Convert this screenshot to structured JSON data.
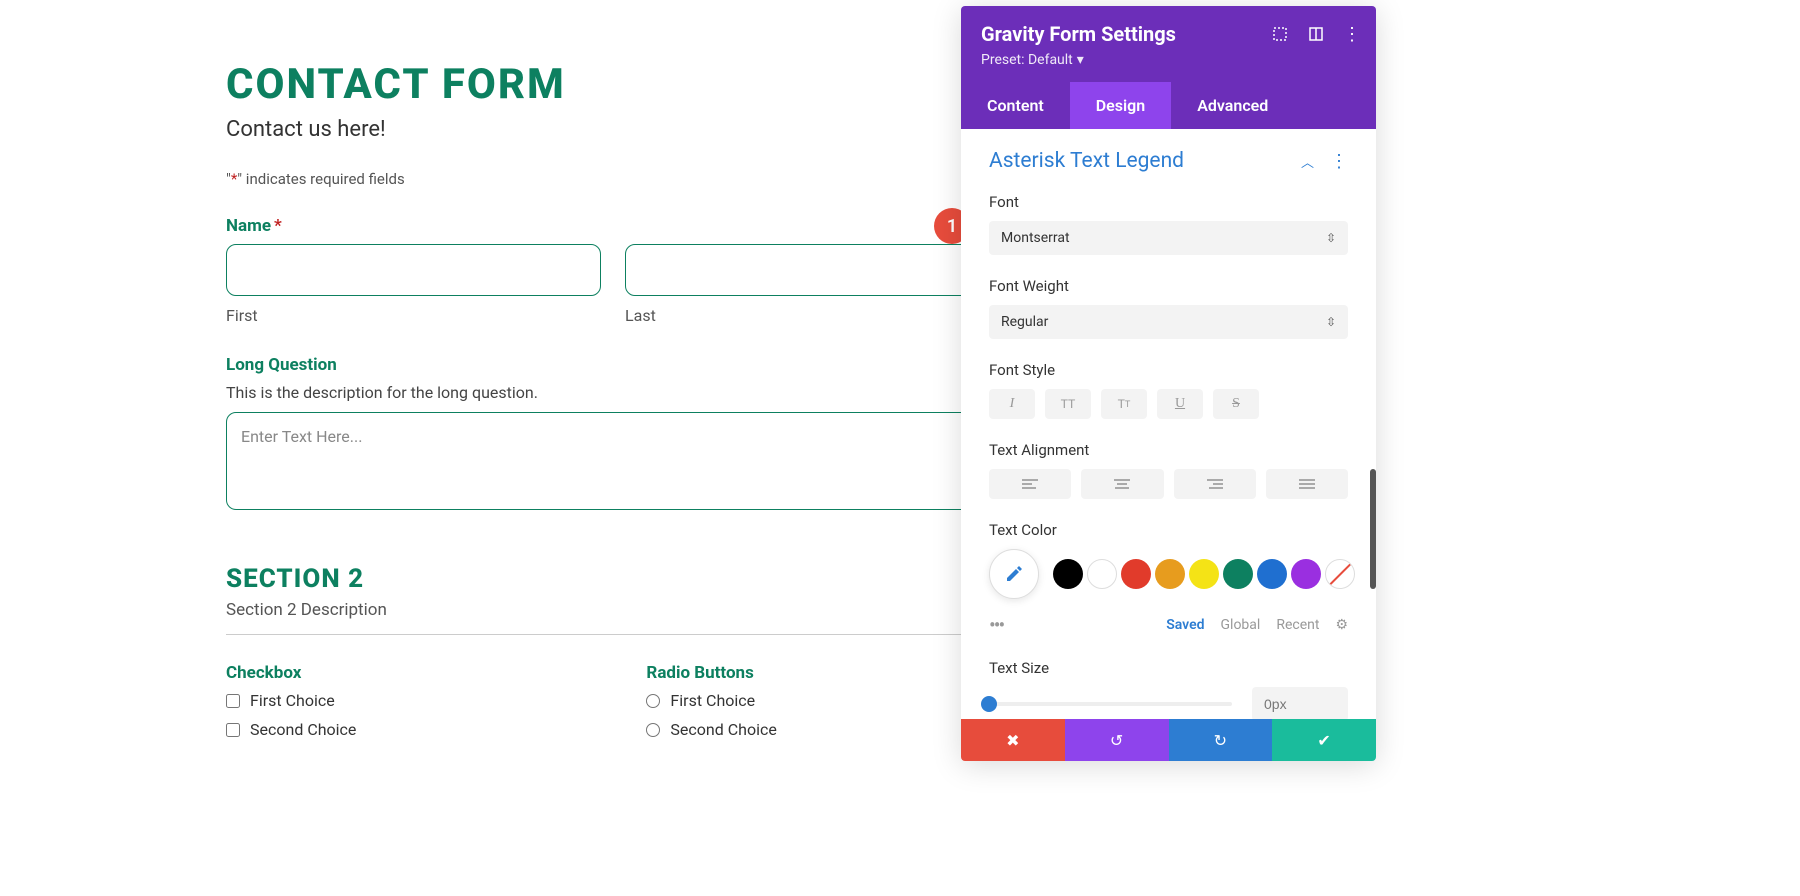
{
  "form": {
    "title": "CONTACT FORM",
    "subtitle": "Contact us here!",
    "required_note_prefix": "\"",
    "required_note_ast": "*",
    "required_note_suffix": "\" indicates required fields",
    "name": {
      "label": "Name",
      "first_label": "First",
      "last_label": "Last"
    },
    "long_question": {
      "label": "Long Question",
      "description": "This is the description for the long question.",
      "placeholder": "Enter Text Here..."
    },
    "section2": {
      "title": "SECTION 2",
      "description": "Section 2 Description"
    },
    "checkbox": {
      "label": "Checkbox",
      "options": [
        "First Choice",
        "Second Choice"
      ]
    },
    "radio": {
      "label": "Radio Buttons",
      "options": [
        "First Choice",
        "Second Choice"
      ]
    }
  },
  "badge": {
    "number": "1"
  },
  "panel": {
    "title": "Gravity Form Settings",
    "preset_label": "Preset: Default",
    "tabs": {
      "content": "Content",
      "design": "Design",
      "advanced": "Advanced"
    },
    "section_title": "Asterisk Text Legend",
    "font": {
      "label": "Font",
      "value": "Montserrat"
    },
    "font_weight": {
      "label": "Font Weight",
      "value": "Regular"
    },
    "font_style": {
      "label": "Font Style"
    },
    "text_alignment": {
      "label": "Text Alignment"
    },
    "text_color": {
      "label": "Text Color",
      "swatches": [
        "#000000",
        "#ffffff",
        "#e13b2b",
        "#e79c1e",
        "#f4e316",
        "#0d8060",
        "#1f6fd0",
        "#9a2fe0"
      ],
      "tabs": {
        "saved": "Saved",
        "global": "Global",
        "recent": "Recent"
      }
    },
    "text_size": {
      "label": "Text Size",
      "value": "0px"
    }
  }
}
